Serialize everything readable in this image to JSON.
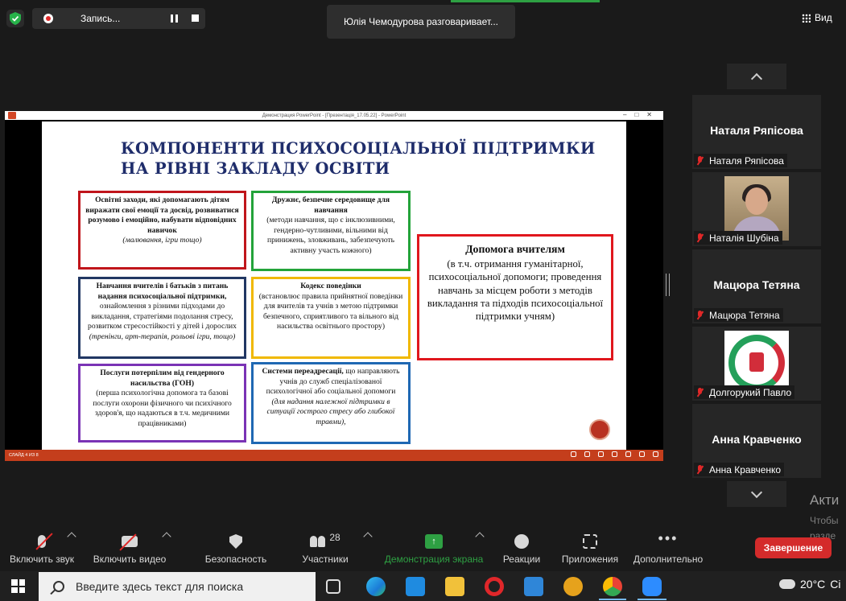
{
  "top": {
    "recording_label": "Запись...",
    "speaking_text": "Юлія Чемодурова разговаривает...",
    "view_label": "Вид"
  },
  "presentation": {
    "window_title": "Демонстрация PowerPoint - [Презентація_17.05.22] - PowerPoint",
    "status_text": "СЛАЙД 4 ИЗ 8",
    "slide_title_line1": "КОМПОНЕНТИ ПСИХОСОЦІАЛЬНОЇ ПІДТРИМКИ",
    "slide_title_line2": "НА РІВНІ ЗАКЛАДУ ОСВІТИ",
    "box1_bold": "Освітні заходи, які допомагають дітям виражати свої емоції та досвід, розвиватися розумово і емоційно, набувати відповідних навичок",
    "box1_italic": "(малювання, ігри тощо)",
    "box2_bold": "Дружнє, безпечне середовище для навчання",
    "box2_text": "(методи навчання, що є інклюзивними, гендерно-чутливими, вільними від принижень, зловживань, забезпечують активну участь кожного)",
    "box3_bold": "Навчання вчителів і батьків з питань надання психосоціальної підтримки,",
    "box3_text": "ознайомлення з різними підходами до викладання, стратегіями подолання стресу, розвитком стресостійкості у дітей і дорослих",
    "box3_italic": "(тренінги, арт-терапія, рольові ігри, тощо)",
    "box4_bold": "Кодекс поведінки",
    "box4_text": "(встановлює правила прийнятної поведінки для вчителів та учнів з метою підтримки безпечного, сприятливого та вільного від насильства освітнього простору)",
    "box5_bold": "Послуги потерпілим від гендерного насильства (ГОН)",
    "box5_text": "(перша психологічна допомога та базові послуги охорони фізичного чи психічного здоров'я, що надаються в т.ч. медичними працівниками)",
    "box6_bold": "Системи переадресації,",
    "box6_text": "що направляють учнів до служб спеціалізованої психологічної або соціальної допомоги",
    "box6_italic": "(для надання належної підтримки в ситуації гострого стресу або глибокої травми),",
    "box7_title": "Допомога вчителям",
    "box7_text": "(в т.ч. отримання гуманітарної, психосоціальної допомоги; проведення навчань за місцем роботи з методів викладання та підходів психосоціальної підтримки учням)"
  },
  "participants": [
    {
      "big_name": "Наталя Ряпісова",
      "tag": "Наталя Ряпісова",
      "type": "name"
    },
    {
      "big_name": "",
      "tag": "Наталія Шубіна",
      "type": "photo"
    },
    {
      "big_name": "Мацюра Тетяна",
      "tag": "Мацюра Тетяна",
      "type": "name"
    },
    {
      "big_name": "",
      "tag": "Долгорукий Павло",
      "type": "logo"
    },
    {
      "big_name": "Анна Кравченко",
      "tag": "Анна Кравченко",
      "type": "name"
    }
  ],
  "watermark": {
    "line1": "Акти",
    "line2": "Чтобы",
    "line3": "разде"
  },
  "toolbar": {
    "mute_label": "Включить звук",
    "video_label": "Включить видео",
    "security_label": "Безопасность",
    "participants_label": "Участники",
    "participants_count": "28",
    "share_label": "Демонстрация экрана",
    "reactions_label": "Реакции",
    "apps_label": "Приложения",
    "more_label": "Дополнительно",
    "end_label": "Завершение"
  },
  "taskbar": {
    "search_placeholder": "Введите здесь текст для поиска",
    "weather": "20°C",
    "weather_extra": "Ci"
  },
  "colors": {
    "zoom_bg": "#1a1a1a",
    "share_green": "#2ea043",
    "end_red": "#d42b2b",
    "slide_title": "#1f2d6b",
    "ppt_accent": "#c43e1c"
  }
}
